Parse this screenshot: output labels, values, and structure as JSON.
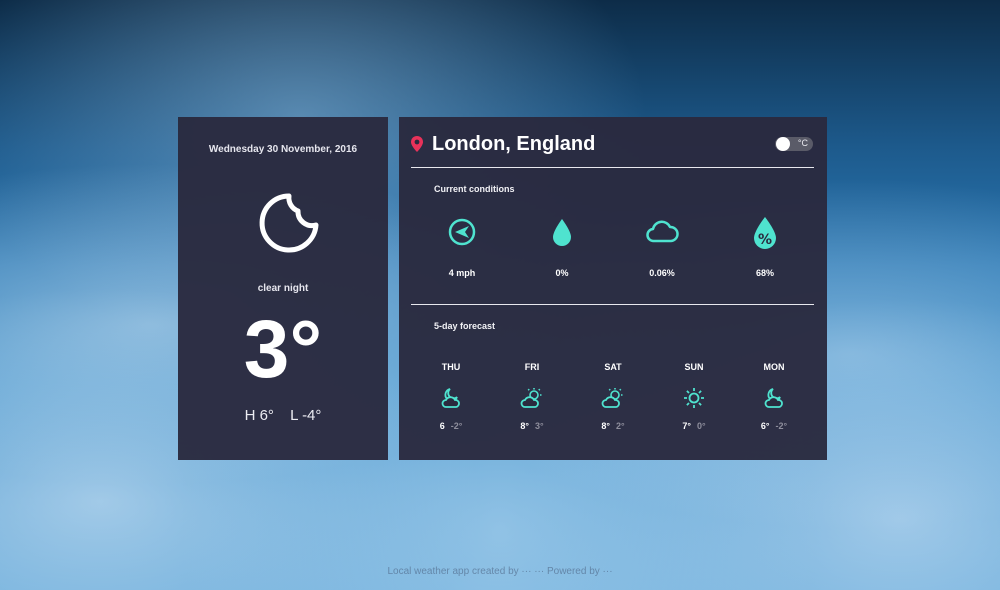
{
  "left_panel": {
    "date": "Wednesday 30 November, 2016",
    "icon": "clear-night-moon-icon",
    "summary": "clear night",
    "temperature": "3°",
    "high": "H 6°",
    "low": "L -4°"
  },
  "right_panel": {
    "location": "London, England",
    "unit_toggle_label": "°C",
    "current_title": "Current conditions",
    "conditions": [
      {
        "icon": "wind-compass-icon",
        "value": "4 mph"
      },
      {
        "icon": "raindrop-icon",
        "value": "0%"
      },
      {
        "icon": "cloud-icon",
        "value": "0.06%"
      },
      {
        "icon": "humidity-icon",
        "value": "68%"
      }
    ],
    "forecast_title": "5-day forecast",
    "forecast": [
      {
        "day": "THU",
        "icon": "partly-cloudy-night-icon",
        "high": "6",
        "low": "-2°"
      },
      {
        "day": "FRI",
        "icon": "partly-cloudy-day-icon",
        "high": "8°",
        "low": "3°"
      },
      {
        "day": "SAT",
        "icon": "partly-cloudy-day-icon",
        "high": "8°",
        "low": "2°"
      },
      {
        "day": "SUN",
        "icon": "sun-icon",
        "high": "7°",
        "low": "0°"
      },
      {
        "day": "MON",
        "icon": "partly-cloudy-night-icon",
        "high": "6°",
        "low": "-2°"
      }
    ]
  },
  "colors": {
    "accent": "#4fe3cf",
    "pin": "#e8325a",
    "card": "#2a2a3e"
  },
  "footer": {
    "text": "Local weather app created by ··· ··· Powered by ···"
  }
}
